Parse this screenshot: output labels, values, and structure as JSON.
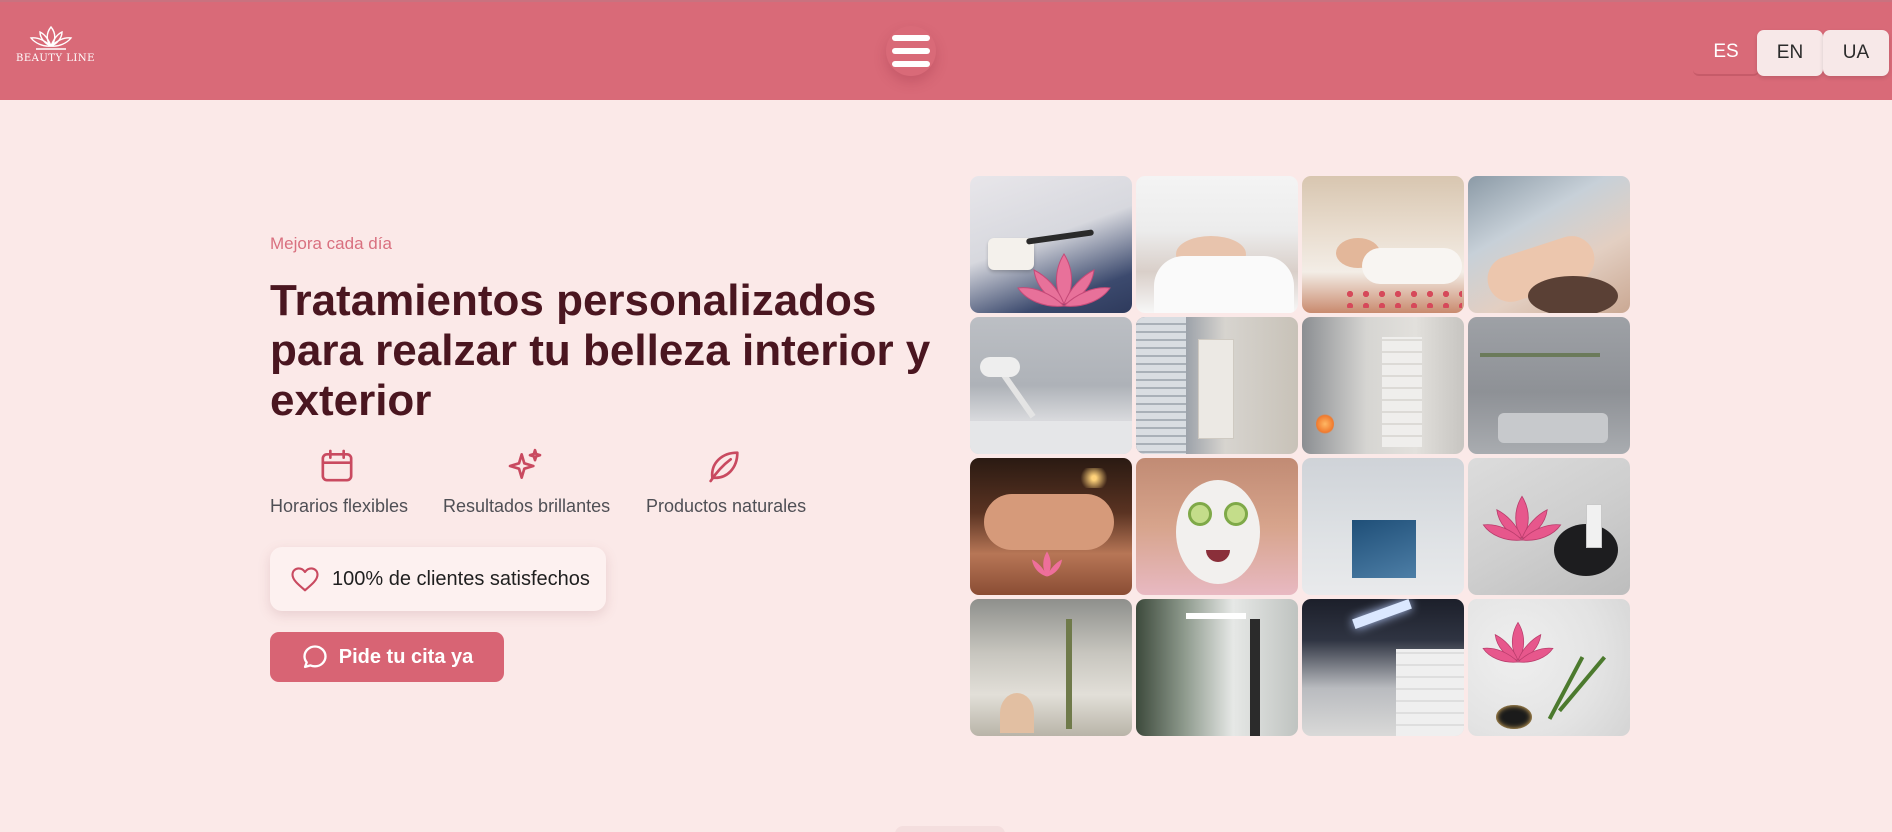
{
  "header": {
    "logo_text": "BEAUTY LINE",
    "menu_icon": "hamburger-menu-icon",
    "languages": [
      "ES",
      "EN",
      "UA"
    ],
    "active_language": "ES",
    "background_color": "#d96a78"
  },
  "hero": {
    "eyebrow": "Mejora cada día",
    "title": "Tratamientos personalizados para realzar tu belleza interior y exterior",
    "features": [
      {
        "icon": "calendar-icon",
        "label": "Horarios flexibles"
      },
      {
        "icon": "sparkles-icon",
        "label": "Resultados brillantes"
      },
      {
        "icon": "leaf-icon",
        "label": "Productos naturales"
      }
    ],
    "satisfaction": {
      "icon": "heart-icon",
      "label": "100% de clientes satisfechos"
    },
    "cta": {
      "icon": "chat-bubble-icon",
      "label": "Pide tu cita ya"
    }
  },
  "gallery": {
    "rows": 4,
    "columns": 4,
    "images": [
      "cream-jar-with-lotus",
      "facial-treatment",
      "relaxing-client",
      "facial-massage",
      "treatment-room-lamp",
      "treatment-room-cabinet",
      "candle-corner",
      "treatment-bed-room",
      "back-massage-candles",
      "face-mask-cucumbers",
      "product-poster-wall",
      "lotus-with-products",
      "salon-interior-mirror",
      "salon-entrance",
      "salon-ceiling-light",
      "lotus-candle-decor"
    ]
  },
  "colors": {
    "accent": "#d96a78",
    "title": "#4a1620",
    "page_background": "#fbe9e8",
    "icon": "#c94a60"
  }
}
